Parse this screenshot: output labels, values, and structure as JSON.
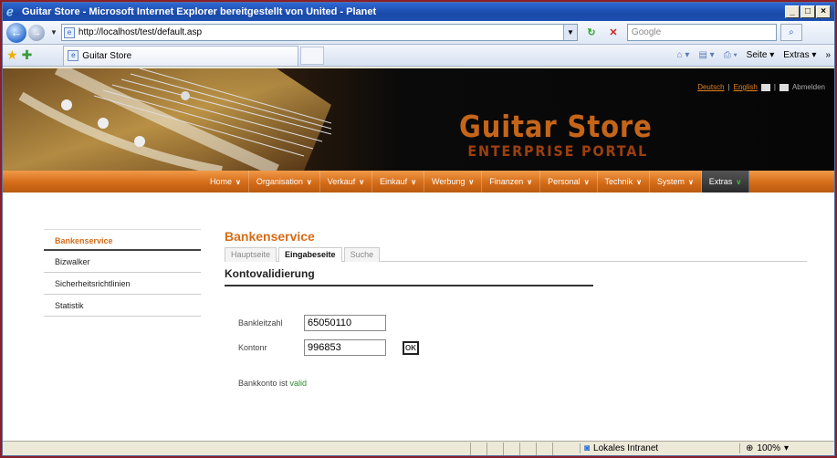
{
  "window": {
    "title": "Guitar Store - Microsoft Internet Explorer bereitgestellt von United - Planet"
  },
  "address_bar": {
    "url": "http://localhost/test/default.asp",
    "search_placeholder": "Google"
  },
  "tab": {
    "label": "Guitar Store"
  },
  "commands": {
    "page": "Seite",
    "extras": "Extras"
  },
  "banner": {
    "logo_line1": "Guitar Store",
    "logo_line2": "ENTERPRISE PORTAL",
    "lang_de": "Deutsch",
    "lang_sep": "|",
    "lang_en": "English",
    "logout": "Abmelden"
  },
  "menu": [
    {
      "label": "Home"
    },
    {
      "label": "Organisation"
    },
    {
      "label": "Verkauf"
    },
    {
      "label": "Einkauf"
    },
    {
      "label": "Werbung"
    },
    {
      "label": "Finanzen"
    },
    {
      "label": "Personal"
    },
    {
      "label": "Technik"
    },
    {
      "label": "System"
    },
    {
      "label": "Extras"
    }
  ],
  "sidebar": {
    "items": [
      {
        "label": "Bankenservice"
      },
      {
        "label": "Bizwalker"
      },
      {
        "label": "Sicherheitsrichtlinien"
      },
      {
        "label": "Statistik"
      }
    ]
  },
  "content": {
    "title": "Bankenservice",
    "tabs": [
      {
        "label": "Hauptseite"
      },
      {
        "label": "Eingabeseite"
      },
      {
        "label": "Suche"
      }
    ],
    "section_title": "Kontovalidierung",
    "blz_label": "Bankleitzahl",
    "blz_value": "65050110",
    "konto_label": "Kontonr",
    "konto_value": "996853",
    "ok_label": "OK",
    "result_prefix": "Bankkonto ist",
    "result_status": "valid"
  },
  "statusbar": {
    "zone": "Lokales Intranet",
    "zoom": "100%"
  },
  "colors": {
    "accent": "#d56c18",
    "valid": "#2e8a2e",
    "titlebar": "#1a4aa8"
  }
}
